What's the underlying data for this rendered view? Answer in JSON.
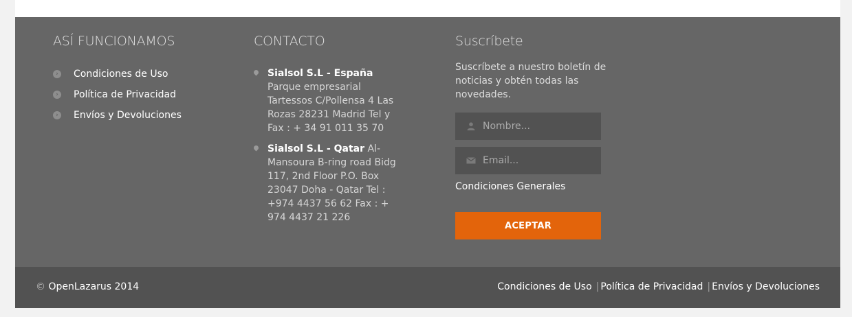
{
  "footer": {
    "how_it_works": {
      "title": "ASÍ FUNCIONAMOS",
      "links": [
        "Condiciones de Uso",
        "Política de Privacidad",
        "Envíos y Devoluciones"
      ]
    },
    "contact": {
      "title": "CONTACTO",
      "items": [
        {
          "name": "Sialsol S.L - España",
          "text": " Parque empresarial Tartessos C/Pollensa 4 Las Rozas 28231 Madrid Tel y Fax : + 34 91 011 35 70"
        },
        {
          "name": "Sialsol S.L - Qatar",
          "text": " Al-Mansoura B-ring road Bidg 117, 2nd Floor P.O. Box 23047 Doha - Qatar Tel : +974 4437 56 62 Fax : + 974 4437 21 226"
        }
      ]
    },
    "subscribe": {
      "title": "Suscríbete",
      "description": "Suscríbete a nuestro boletín de noticias y obtén todas las novedades.",
      "name_placeholder": "Nombre...",
      "email_placeholder": "Email...",
      "conditions_link": "Condiciones Generales",
      "submit_label": "ACEPTAR",
      "accent_color": "#e3640b"
    }
  },
  "bottom_bar": {
    "copyright_symbol": "©",
    "copyright_text": "OpenLazarus 2014",
    "links": [
      "Condiciones de Uso",
      "Política de Privacidad",
      "Envíos y Devoluciones"
    ],
    "separator": "|"
  }
}
